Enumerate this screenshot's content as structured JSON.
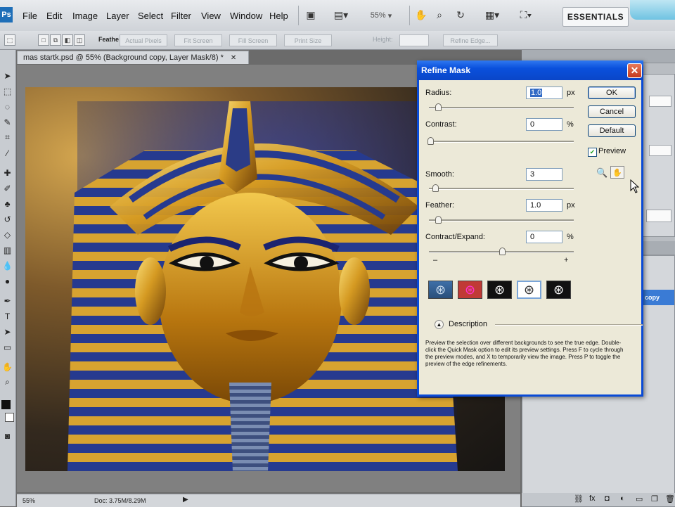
{
  "menubar": {
    "logo": "Ps",
    "items": [
      "File",
      "Edit",
      "Image",
      "Layer",
      "Select",
      "Filter",
      "View",
      "Window",
      "Help"
    ],
    "zoom": "55%",
    "workspace": "ESSENTIALS"
  },
  "optionsbar": {
    "feather_label": "Feathe",
    "actual_pixels": "Actual Pixels",
    "fit_screen": "Fit Screen",
    "fill_screen": "Fill Screen",
    "print_size": "Print Size",
    "height_label": "Height:",
    "refine_edge": "Refine Edge..."
  },
  "document": {
    "tab_title": "mas startk.psd @ 55% (Background copy, Layer Mask/8) *",
    "status_zoom": "55%",
    "status_doc": "Doc: 3.75M/8.29M"
  },
  "dock": {
    "layer_name": "copy"
  },
  "dialog": {
    "title": "Refine Mask",
    "close": "✕",
    "radius": {
      "label": "Radius:",
      "value": "1.0",
      "unit": "px"
    },
    "contrast": {
      "label": "Contrast:",
      "value": "0",
      "unit": "%"
    },
    "smooth": {
      "label": "Smooth:",
      "value": "3"
    },
    "feather": {
      "label": "Feather:",
      "value": "1.0",
      "unit": "px"
    },
    "contract_expand": {
      "label": "Contract/Expand:",
      "value": "0",
      "unit": "%",
      "minus": "–",
      "plus": "+"
    },
    "ok": "OK",
    "cancel": "Cancel",
    "default": "Default",
    "preview_label": "Preview",
    "preview_checked": true,
    "description_label": "Description",
    "description_text": "Preview the selection over different backgrounds to see the true edge. Double-click the Quick Mask option to edit its preview settings. Press F to cycle through the preview modes, and X to temporarily view the image. Press P to toggle the preview of the edge refinements."
  },
  "colors": {
    "dialog_title_bar": "#0a50dc",
    "dialog_face": "#ece9d8",
    "selection_highlight": "#316ac5"
  }
}
